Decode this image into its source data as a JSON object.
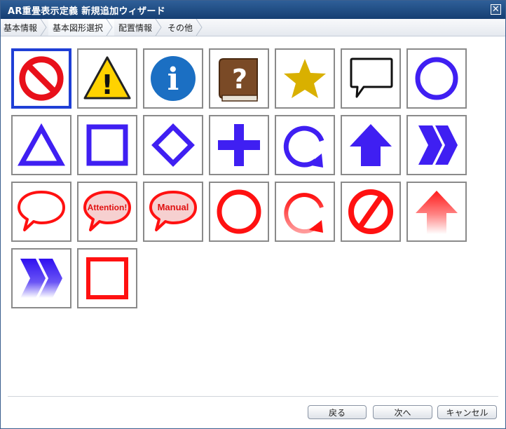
{
  "window": {
    "title": "AR重畳表示定義 新規追加ウィザード",
    "close_glyph": "✕"
  },
  "steps": [
    {
      "label": "基本情報",
      "active": false
    },
    {
      "label": "基本図形選択",
      "active": true
    },
    {
      "label": "配置情報",
      "active": false
    },
    {
      "label": "その他",
      "active": false
    }
  ],
  "shape_text": {
    "attention": "Attention!",
    "manual": "Manual",
    "info": "i",
    "help": "?",
    "warning": "!"
  },
  "colors": {
    "selection_border": "#1f3fd6",
    "blue_shape": "#3f1ff2",
    "red_shape": "#ff1111"
  },
  "buttons": {
    "back": "戻る",
    "next": "次へ",
    "cancel": "キャンセル"
  }
}
